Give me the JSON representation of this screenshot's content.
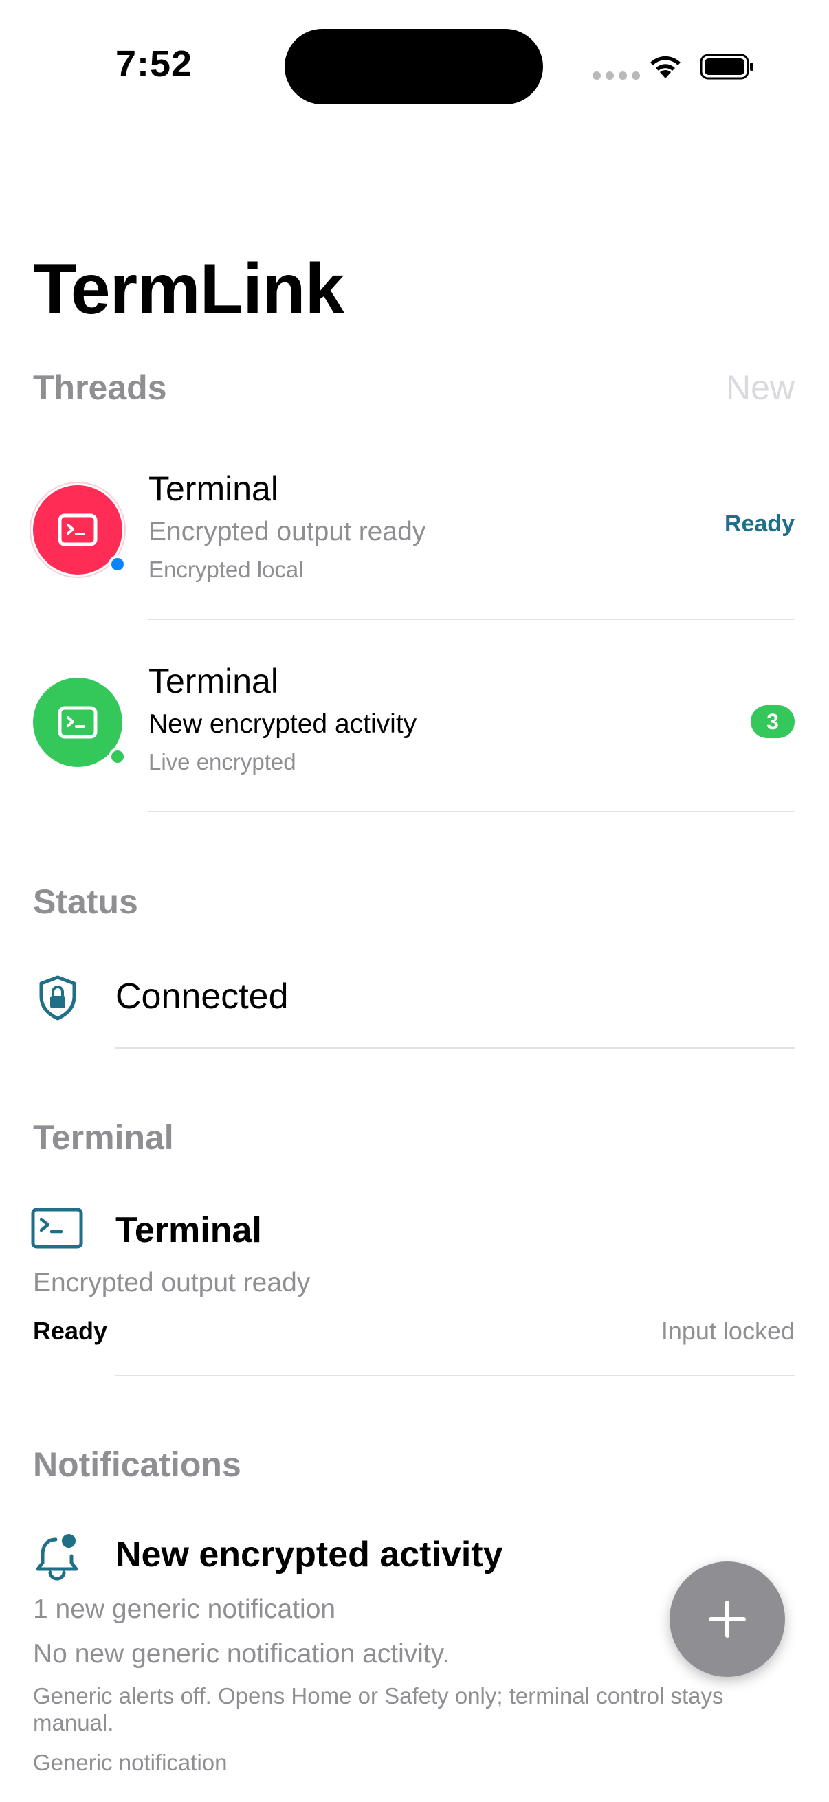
{
  "status_bar": {
    "time": "7:52",
    "icons": [
      "cellular-icon",
      "wifi-icon",
      "battery-icon"
    ]
  },
  "app_title": "TermLink",
  "threads": {
    "section_label": "Threads",
    "new_label": "New",
    "items": [
      {
        "title": "Terminal",
        "subtitle": "Encrypted output ready",
        "meta": "Encrypted local",
        "trailing": "Ready",
        "avatar_color": "#ff2d55",
        "dot_color": "#0a84ff",
        "icon": "terminal-icon"
      },
      {
        "title": "Terminal",
        "subtitle": "New encrypted activity",
        "meta": "Live encrypted",
        "badge": "3",
        "avatar_color": "#34c759",
        "dot_color": "#34c759",
        "icon": "terminal-icon"
      }
    ]
  },
  "status": {
    "section_label": "Status",
    "value": "Connected",
    "icon": "shield-lock-icon"
  },
  "terminal": {
    "section_label": "Terminal",
    "title": "Terminal",
    "subtitle": "Encrypted output ready",
    "state": "Ready",
    "input_state": "Input locked",
    "icon": "terminal-icon"
  },
  "notifications": {
    "section_label": "Notifications",
    "title": "New encrypted activity",
    "count_line": "1 new generic notification",
    "activity_line": "No new generic notification activity.",
    "description": "Generic alerts off. Opens Home or Safety only; terminal control stays manual.",
    "kind": "Generic notification",
    "icon": "bell-badge-icon"
  },
  "fab": {
    "icon": "plus-icon"
  },
  "colors": {
    "accent": "#1f6f87",
    "label_gray": "#8e8e93",
    "red": "#ff2d55",
    "green": "#34c759",
    "blue": "#0a84ff"
  }
}
